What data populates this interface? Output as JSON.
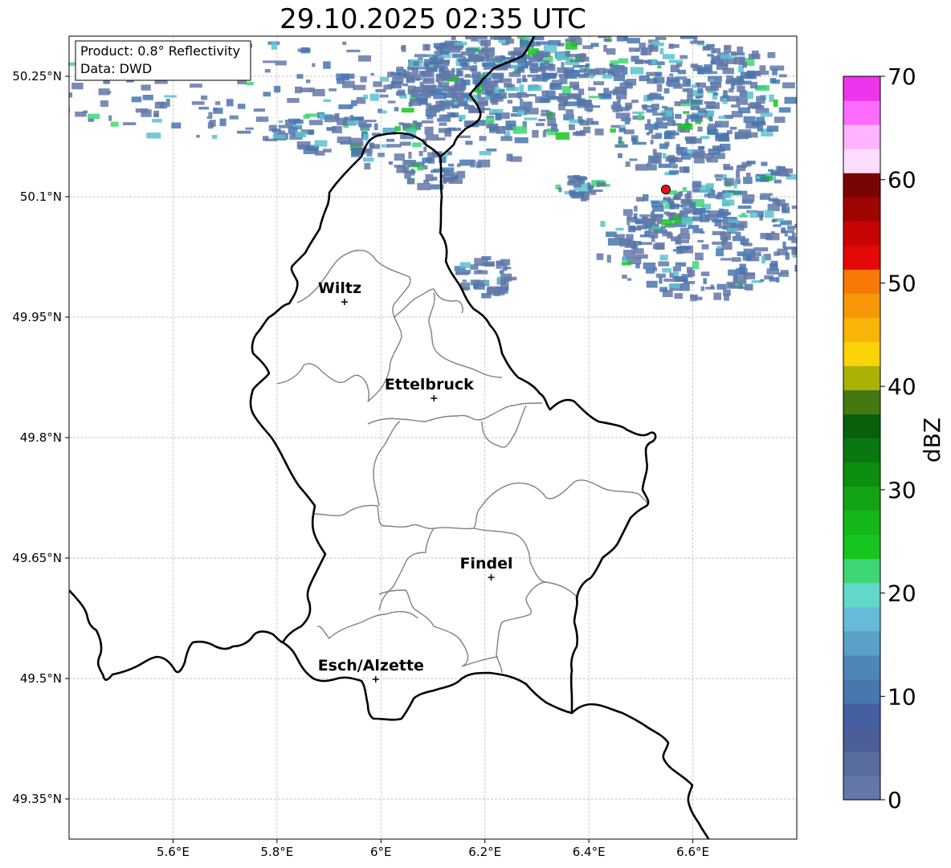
{
  "title": "29.10.2025 02:35 UTC",
  "info_box": {
    "line1": "Product: 0.8° Reflectivity",
    "line2": "Data: DWD"
  },
  "map": {
    "lon_range": [
      5.4,
      6.8
    ],
    "lat_range": [
      49.3,
      50.3
    ],
    "lon_ticks": [
      {
        "value": 5.6,
        "label": "5.6°E"
      },
      {
        "value": 5.8,
        "label": "5.8°E"
      },
      {
        "value": 6.0,
        "label": "6°E"
      },
      {
        "value": 6.2,
        "label": "6.2°E"
      },
      {
        "value": 6.4,
        "label": "6.4°E"
      },
      {
        "value": 6.6,
        "label": "6.6°E"
      }
    ],
    "lat_ticks": [
      {
        "value": 50.25,
        "label": "50.25°N"
      },
      {
        "value": 50.1,
        "label": "50.1°N"
      },
      {
        "value": 49.95,
        "label": "49.95°N"
      },
      {
        "value": 49.8,
        "label": "49.8°N"
      },
      {
        "value": 49.65,
        "label": "49.65°N"
      },
      {
        "value": 49.5,
        "label": "49.5°N"
      },
      {
        "value": 49.35,
        "label": "49.35°N"
      }
    ],
    "grid": true,
    "cities": [
      {
        "name": "Wiltz",
        "lon": 5.93,
        "lat": 49.969
      },
      {
        "name": "Ettelbruck",
        "lon": 6.102,
        "lat": 49.849
      },
      {
        "name": "Findel",
        "lon": 6.212,
        "lat": 49.626
      },
      {
        "name": "Esch/Alzette",
        "lon": 5.99,
        "lat": 49.499
      }
    ],
    "radar_site": {
      "lon": 6.548,
      "lat": 50.109,
      "color": "#e8131a"
    }
  },
  "colorbar": {
    "label": "dBZ",
    "min": 0,
    "max": 70,
    "tick_labels": [
      "0",
      "10",
      "20",
      "30",
      "40",
      "50",
      "60",
      "70"
    ],
    "colors": [
      "#6378a8",
      "#586c9e",
      "#4b5e98",
      "#445ea0",
      "#4876ae",
      "#4e86b8",
      "#5aa0c8",
      "#66bcd8",
      "#62d8c8",
      "#3ed674",
      "#16c61e",
      "#14b81a",
      "#12a414",
      "#0c8e0e",
      "#0a7810",
      "#08600c",
      "#447810",
      "#aab208",
      "#fad408",
      "#f8b408",
      "#f89808",
      "#f87808",
      "#e40808",
      "#c80404",
      "#a00404",
      "#780404",
      "#ffdcff",
      "#ffb4ff",
      "#fc6cfc",
      "#ec34ec"
    ]
  },
  "reflectivity_colors": {
    "low": "#6378a8",
    "mid": "#4876ae",
    "cyan": "#5ac2d0",
    "green": "#3ed674",
    "bright_green": "#16c61e"
  },
  "outline_colors": {
    "border": "#000000",
    "cantons": "#808080"
  }
}
